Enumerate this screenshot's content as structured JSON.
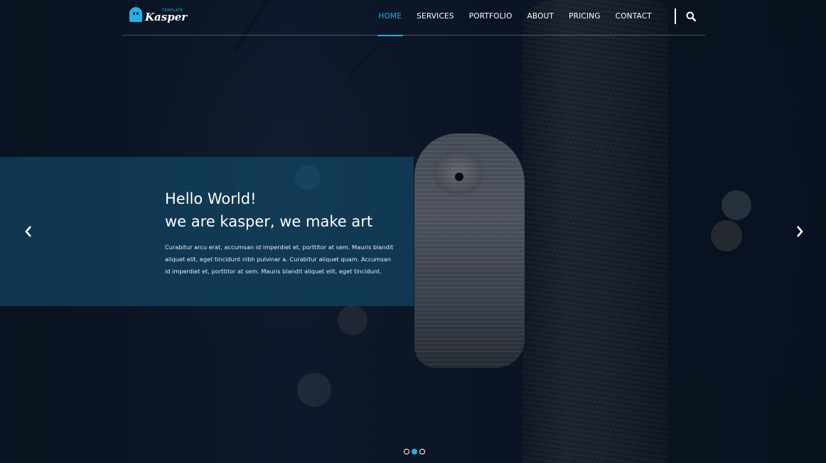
{
  "brand": {
    "name": "Kasper",
    "tagline": "TEMPLATE",
    "accent_color": "#21b2e5",
    "logo_icon": "ghost-icon"
  },
  "nav": {
    "items": [
      {
        "label": "HOME",
        "active": true
      },
      {
        "label": "SERVICES",
        "active": false
      },
      {
        "label": "PORTFOLIO",
        "active": false
      },
      {
        "label": "ABOUT",
        "active": false
      },
      {
        "label": "PRICING",
        "active": false
      },
      {
        "label": "CONTACT",
        "active": false
      }
    ],
    "search_icon": "search-icon"
  },
  "hero": {
    "title_line1": "Hello World!",
    "title_line2": "we are kasper, we make art",
    "body": "Curabitur arcu erat, accumsan id imperdiet et, porttitor at sem. Mauris blandit aliquet elit, eget tincidunt nibh pulvinar a. Curabitur aliquet quam. Accumsan id imperdiet et, porttitor at sem. Mauris blandit aliquet elit, eget tincidunt.",
    "box_color": "#144e6e"
  },
  "slider": {
    "prev_icon": "chevron-left-icon",
    "next_icon": "chevron-right-icon",
    "total_slides": 3,
    "active_slide": 2
  }
}
